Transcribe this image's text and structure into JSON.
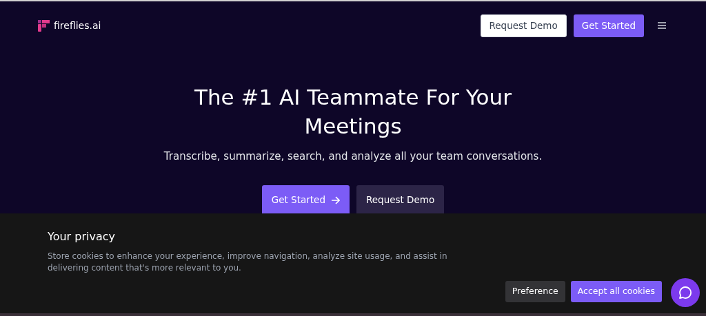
{
  "header": {
    "logo_text": "fireflies.ai",
    "buttons": [
      {
        "label": "Request Demo",
        "kind": "secondary"
      },
      {
        "label": "Get Started",
        "kind": "primary"
      }
    ]
  },
  "hero": {
    "title": "The #1 AI Teammate For Your Meetings",
    "subtitle": "Transcribe, summarize, search, and analyze all your team conversations.",
    "buttons": [
      {
        "label": "Get Started",
        "kind": "primary"
      },
      {
        "label": "Request Demo",
        "kind": "dark"
      }
    ]
  },
  "cookie_banner": {
    "title": "Your privacy",
    "text": "Store cookies to enhance your experience, improve navigation, analyze site usage, and assist in delivering content that's more relevant to you.",
    "buttons": [
      {
        "label": "Preference",
        "kind": "dark"
      },
      {
        "label": "Accept all cookies",
        "kind": "primary"
      }
    ]
  }
}
